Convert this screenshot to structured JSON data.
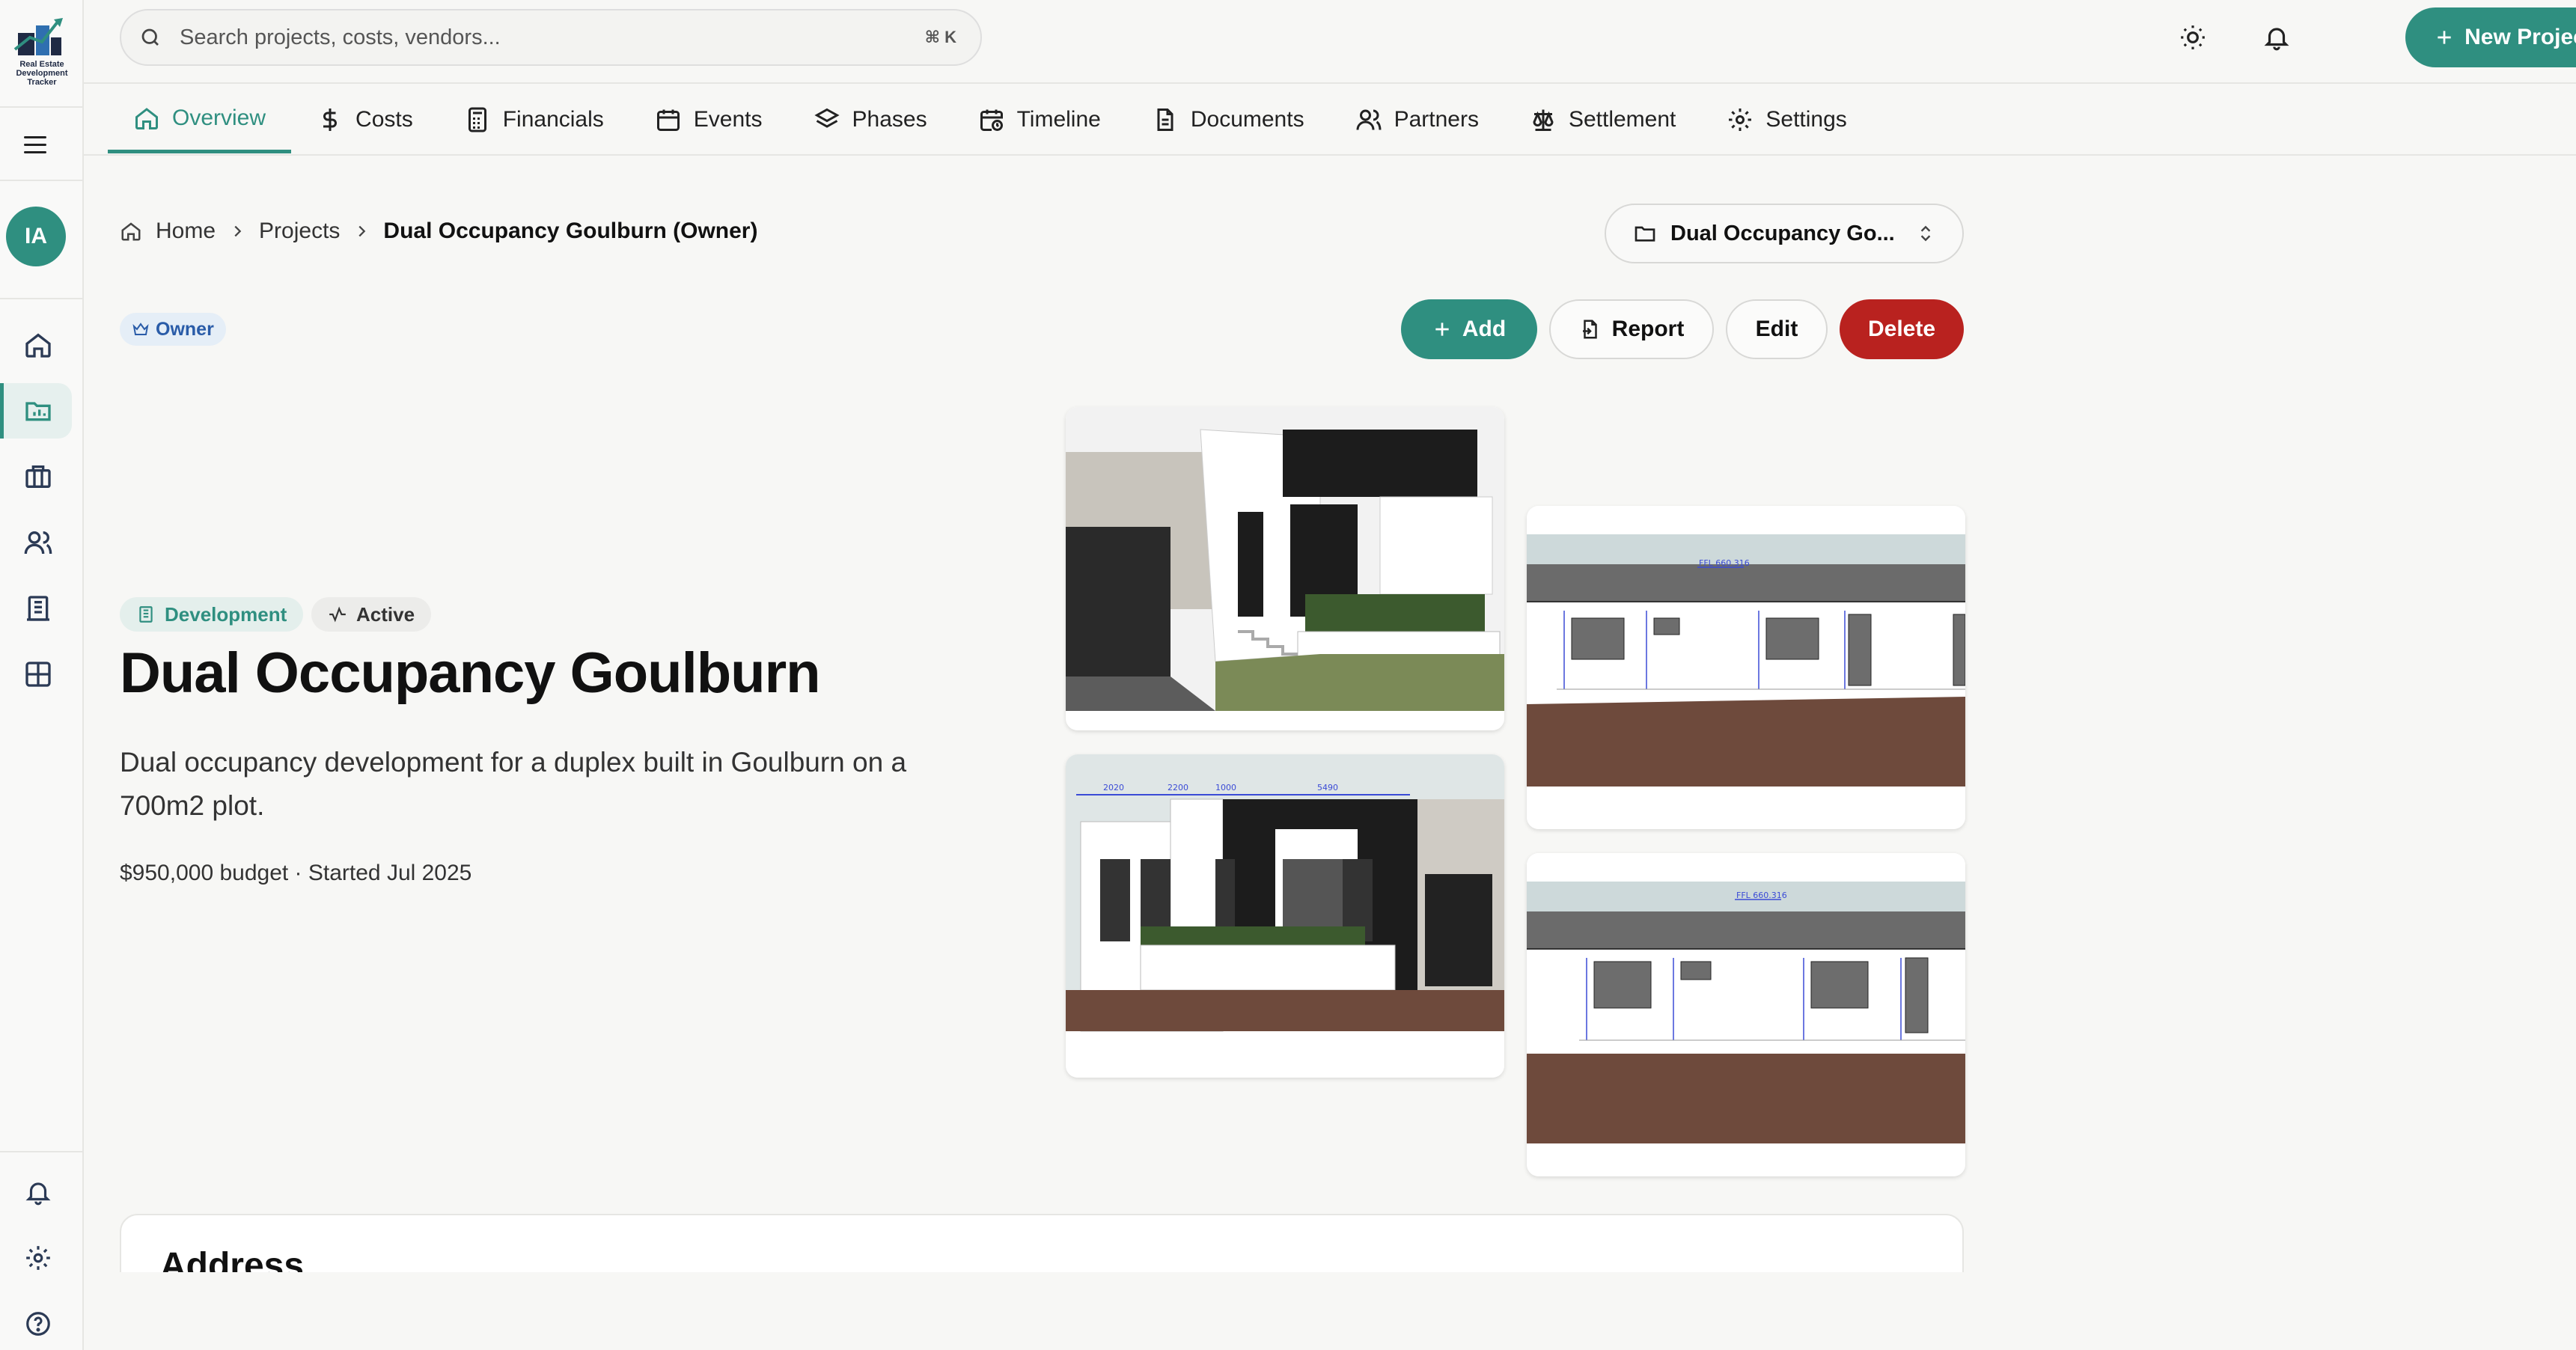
{
  "app": {
    "logo_text": "Real Estate Development Tracker",
    "user_initials": "IA"
  },
  "search": {
    "placeholder": "Search projects, costs, vendors...",
    "shortcut": "⌘ K"
  },
  "header": {
    "new_project_label": "New Project"
  },
  "tabs": [
    {
      "label": "Overview",
      "icon": "home-icon",
      "active": true
    },
    {
      "label": "Costs",
      "icon": "dollar-icon"
    },
    {
      "label": "Financials",
      "icon": "calculator-icon"
    },
    {
      "label": "Events",
      "icon": "calendar-icon"
    },
    {
      "label": "Phases",
      "icon": "layers-icon"
    },
    {
      "label": "Timeline",
      "icon": "calendar-clock-icon"
    },
    {
      "label": "Documents",
      "icon": "file-text-icon"
    },
    {
      "label": "Partners",
      "icon": "users-icon"
    },
    {
      "label": "Settlement",
      "icon": "scale-icon"
    },
    {
      "label": "Settings",
      "icon": "gear-icon"
    }
  ],
  "breadcrumb": {
    "home": "Home",
    "projects": "Projects",
    "current": "Dual Occupancy Goulburn (Owner)"
  },
  "project_selector": {
    "value": "Dual Occupancy Go..."
  },
  "role_badge": "Owner",
  "actions": {
    "add": "Add",
    "report": "Report",
    "edit": "Edit",
    "delete": "Delete"
  },
  "project": {
    "type_tag": "Development",
    "status_tag": "Active",
    "title": "Dual Occupancy Goulburn",
    "description": "Dual occupancy development for a duplex built in Goulburn on a 700m2 plot.",
    "meta": "$950,000 budget · Started Jul 2025"
  },
  "images": [
    {
      "name": "render-3d-perspective",
      "labels": []
    },
    {
      "name": "render-front-elevation",
      "labels": [
        "2020",
        "2200",
        "1000",
        "5490"
      ]
    },
    {
      "name": "elevation-drawing-1",
      "labels": [
        "FFL 660.316"
      ]
    },
    {
      "name": "elevation-drawing-2",
      "labels": [
        "FFL 660.316"
      ]
    }
  ],
  "sections": {
    "address_title": "Address"
  },
  "colors": {
    "brand": "#2f8f80",
    "danger": "#b9221f",
    "owner_badge": "#2a5ca8"
  }
}
